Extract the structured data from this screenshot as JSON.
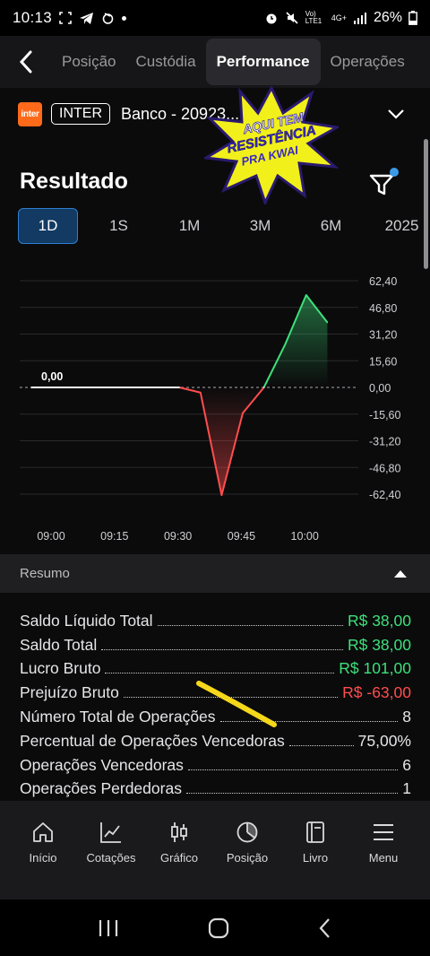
{
  "status_bar": {
    "time": "10:13",
    "battery": "26%",
    "network": "4G+",
    "volte": "Vo) LTE1"
  },
  "top_tabs": [
    {
      "label": "Posição",
      "active": false
    },
    {
      "label": "Custódia",
      "active": false
    },
    {
      "label": "Performance",
      "active": true
    },
    {
      "label": "Operações",
      "active": false
    }
  ],
  "account": {
    "logo_text": "inter",
    "badge": "INTER",
    "name": "Banco - 20923..."
  },
  "sticker": {
    "line1": "AQUI TEM",
    "line2": "RESISTÊNCIA",
    "line3": "PRA KWAI"
  },
  "section": {
    "title": "Resultado"
  },
  "periods": [
    {
      "label": "1D",
      "active": true
    },
    {
      "label": "1S",
      "active": false
    },
    {
      "label": "1M",
      "active": false
    },
    {
      "label": "3M",
      "active": false
    },
    {
      "label": "6M",
      "active": false
    },
    {
      "label": "2025",
      "active": false
    }
  ],
  "chart_data": {
    "type": "area",
    "x": [
      "09:00",
      "09:05",
      "09:10",
      "09:15",
      "09:20",
      "09:25",
      "09:30",
      "09:35",
      "09:40",
      "09:45",
      "09:50",
      "09:55",
      "10:00",
      "10:05",
      "10:10"
    ],
    "series": [
      {
        "values": [
          0,
          0,
          0,
          0,
          0,
          0,
          0,
          0,
          -3,
          -63,
          -15,
          0,
          25,
          54,
          38
        ]
      }
    ],
    "x_ticks": [
      "09:00",
      "09:15",
      "09:30",
      "09:45",
      "10:00"
    ],
    "y_ticks": [
      "62,40",
      "46,80",
      "31,20",
      "15,60",
      "0,00",
      "-15,60",
      "-31,20",
      "-46,80",
      "-62,40"
    ],
    "ylim": [
      -62.4,
      62.4
    ],
    "start_label": "0,00",
    "colors": {
      "positive": "#3ee07a",
      "negative": "#ff4d4d",
      "baseline": "#ffffff"
    },
    "grid": true
  },
  "summary": {
    "header": "Resumo",
    "rows": [
      {
        "label": "Saldo Líquido Total",
        "value": "R$ 38,00",
        "tone": "green"
      },
      {
        "label": "Saldo Total",
        "value": "R$ 38,00",
        "tone": "green"
      },
      {
        "label": "Lucro Bruto",
        "value": "R$ 101,00",
        "tone": "green"
      },
      {
        "label": "Prejuízo Bruto",
        "value": "R$ -63,00",
        "tone": "red"
      },
      {
        "label": "Número Total de Operações",
        "value": "8",
        "tone": "plain"
      },
      {
        "label": "Percentual de Operações Vencedoras",
        "value": "75,00%",
        "tone": "plain"
      },
      {
        "label": "Operações Vencedoras",
        "value": "6",
        "tone": "plain"
      },
      {
        "label": "Operações Perdedoras",
        "value": "1",
        "tone": "plain"
      }
    ]
  },
  "bottom_nav": [
    {
      "label": "Início",
      "icon": "home-icon"
    },
    {
      "label": "Cotações",
      "icon": "trend-icon"
    },
    {
      "label": "Gráfico",
      "icon": "candles-icon"
    },
    {
      "label": "Posição",
      "icon": "pie-icon"
    },
    {
      "label": "Livro",
      "icon": "book-icon"
    },
    {
      "label": "Menu",
      "icon": "menu-icon"
    }
  ]
}
